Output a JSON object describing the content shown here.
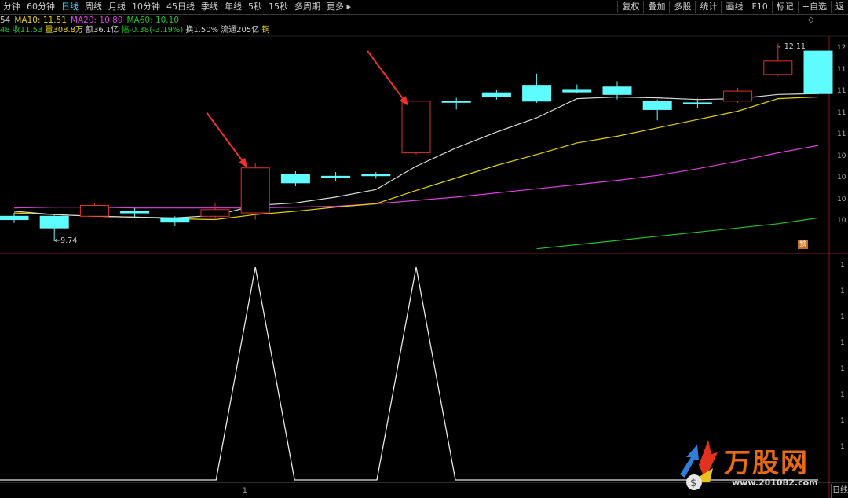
{
  "toolbar": {
    "period_tabs": [
      "分钟",
      "60分钟",
      "日线",
      "周线",
      "月线",
      "10分钟",
      "45日线",
      "季线",
      "年线",
      "5秒",
      "15秒",
      "多周期",
      "更多 ▸"
    ],
    "active_tab": "日线",
    "tools": [
      "复权",
      "叠加",
      "多股",
      "统计",
      "画线",
      "F10",
      "标记",
      "+自选",
      "返"
    ]
  },
  "legend": {
    "prefix": "54",
    "ma10": "MA10: 11.51",
    "ma20": "MA20: 10.89",
    "ma60": "MA60: 10.10"
  },
  "info_line": {
    "open": "48",
    "close": "收11.53",
    "volume": "量308.8万",
    "amount": "额36.1亿",
    "change": "幅-0.38(-3.19%)",
    "turnover": "换1.50%",
    "float_cap": "流通205亿",
    "sector": "铜"
  },
  "price_labels": {
    "high": "12.11",
    "low": "9.74"
  },
  "right_axis_top": [
    "12",
    "11",
    "11",
    "11",
    "11",
    "10",
    "10",
    "10",
    "10"
  ],
  "right_axis_bottom": [
    "1",
    "1",
    "1",
    "1",
    "1",
    "1",
    "1",
    "1"
  ],
  "x_axis_tick": "1",
  "badge": "预",
  "bottom_tab": "日线",
  "watermark": {
    "title": "万股网",
    "url": "www.201082.com"
  },
  "colors": {
    "up": "#e0312f",
    "down": "#5ffcff",
    "ma5": "#d9d9d9",
    "ma10": "#e6d300",
    "ma20": "#e040e0",
    "ma60": "#22c32a",
    "arrow": "#f0322a"
  },
  "chart_data": {
    "type": "candlestick",
    "candles": [
      {
        "o": 10.04,
        "c": 10.0,
        "h": 10.08,
        "l": 9.96
      },
      {
        "o": 10.04,
        "c": 9.9,
        "h": 10.05,
        "l": 9.74
      },
      {
        "o": 10.04,
        "c": 10.17,
        "h": 10.2,
        "l": 10.03
      },
      {
        "o": 10.1,
        "c": 10.08,
        "h": 10.14,
        "l": 10.02
      },
      {
        "o": 10.02,
        "c": 9.97,
        "h": 10.04,
        "l": 9.92
      },
      {
        "o": 10.04,
        "c": 10.12,
        "h": 10.2,
        "l": 10.0
      },
      {
        "o": 10.08,
        "c": 10.62,
        "h": 10.68,
        "l": 10.0
      },
      {
        "o": 10.54,
        "c": 10.44,
        "h": 10.58,
        "l": 10.4
      },
      {
        "o": 10.52,
        "c": 10.5,
        "h": 10.57,
        "l": 10.46
      },
      {
        "o": 10.54,
        "c": 10.53,
        "h": 10.57,
        "l": 10.49
      },
      {
        "o": 10.8,
        "c": 11.42,
        "h": 11.42,
        "l": 10.78
      },
      {
        "o": 11.42,
        "c": 11.41,
        "h": 11.46,
        "l": 11.32
      },
      {
        "o": 11.52,
        "c": 11.47,
        "h": 11.56,
        "l": 11.44
      },
      {
        "o": 11.61,
        "c": 11.42,
        "h": 11.75,
        "l": 11.4
      },
      {
        "o": 11.56,
        "c": 11.53,
        "h": 11.62,
        "l": 11.52
      },
      {
        "o": 11.59,
        "c": 11.5,
        "h": 11.66,
        "l": 11.44
      },
      {
        "o": 11.42,
        "c": 11.32,
        "h": 11.44,
        "l": 11.19
      },
      {
        "o": 11.4,
        "c": 11.39,
        "h": 11.45,
        "l": 11.34
      },
      {
        "o": 11.42,
        "c": 11.54,
        "h": 11.58,
        "l": 11.4
      },
      {
        "o": 11.74,
        "c": 11.9,
        "h": 12.11,
        "l": 11.72
      },
      {
        "o": 12.02,
        "c": 11.51,
        "h": 12.02,
        "l": 11.5
      }
    ],
    "ma5": [
      10.1,
      10.06,
      10.04,
      10.03,
      10.02,
      10.05,
      10.17,
      10.2,
      10.27,
      10.36,
      10.64,
      10.86,
      11.05,
      11.22,
      11.45,
      11.47,
      11.46,
      11.44,
      11.45,
      11.5,
      11.51
    ],
    "ma10": [
      10.08,
      10.06,
      10.04,
      10.03,
      10.01,
      10.0,
      10.06,
      10.1,
      10.15,
      10.19,
      10.35,
      10.5,
      10.65,
      10.78,
      10.92,
      11.0,
      11.1,
      11.2,
      11.3,
      11.45,
      11.47
    ],
    "ma20": [
      10.14,
      10.15,
      10.15,
      10.14,
      10.14,
      10.14,
      10.14,
      10.15,
      10.16,
      10.19,
      10.23,
      10.27,
      10.32,
      10.37,
      10.42,
      10.47,
      10.53,
      10.61,
      10.7,
      10.8,
      10.89
    ],
    "ma60_partial": {
      "from_index": 13,
      "values": [
        9.65,
        9.7,
        9.75,
        9.8,
        9.85,
        9.9,
        9.95,
        10.02
      ]
    },
    "price_range": [
      9.6,
      12.2
    ],
    "indicator": {
      "type": "line",
      "values": [
        0,
        0,
        0,
        0,
        0,
        0,
        1,
        0,
        0,
        0,
        1,
        0,
        0,
        0,
        0,
        0,
        0,
        0,
        0,
        0,
        0
      ],
      "range": [
        0,
        1
      ]
    },
    "annotations": [
      {
        "type": "arrow",
        "target_index": 6
      },
      {
        "type": "arrow",
        "target_index": 10
      }
    ]
  }
}
